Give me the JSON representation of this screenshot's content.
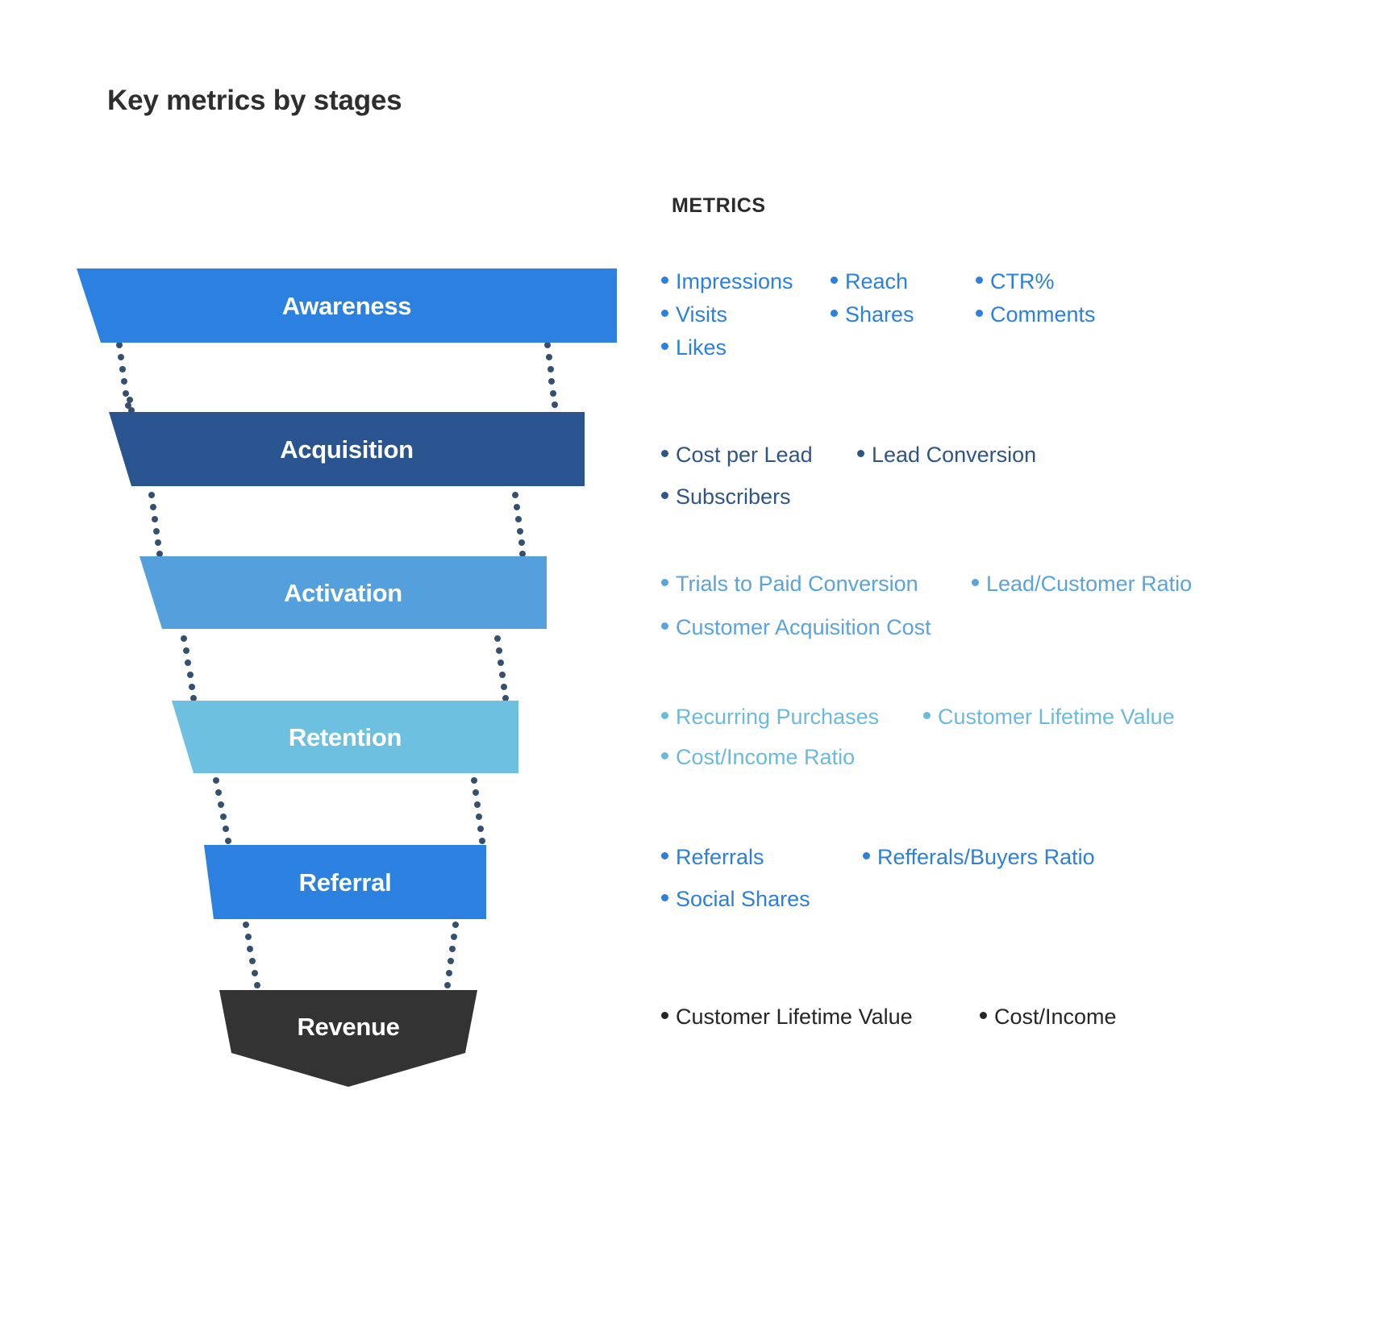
{
  "page": {
    "title": "Key metrics by stages",
    "metrics_heading": "METRICS",
    "background": "#ffffff",
    "title_color": "#2e2e2e"
  },
  "chart_data": {
    "type": "funnel",
    "title": "Key metrics by stages",
    "stages": [
      {
        "name": "Awareness",
        "color": "#2b80e0",
        "text_color": "#2b80e0",
        "metrics": [
          [
            "Impressions",
            "Reach",
            "CTR%"
          ],
          [
            "Visits",
            "Shares",
            "Comments"
          ],
          [
            "Likes"
          ]
        ]
      },
      {
        "name": "Acquisition",
        "color": "#2a5490",
        "text_color": "#2f5488",
        "metrics": [
          [
            "Cost per Lead",
            "Lead Conversion"
          ],
          [
            "Subscribers"
          ]
        ]
      },
      {
        "name": "Activation",
        "color": "#53a0dc",
        "text_color": "#5ba3dc",
        "metrics": [
          [
            "Trials to Paid Conversion",
            "Lead/Customer Ratio"
          ],
          [
            "Customer Acquisition Cost"
          ]
        ]
      },
      {
        "name": "Retention",
        "color": "#6dc0e0",
        "text_color": "#6cbada",
        "metrics": [
          [
            "Recurring Purchases",
            "Customer Lifetime Value"
          ],
          [
            "Cost/Income Ratio"
          ]
        ]
      },
      {
        "name": "Referral",
        "color": "#2b80e0",
        "text_color": "#2d7fd8",
        "metrics": [
          [
            "Referrals",
            "Refferals/Buyers Ratio"
          ],
          [
            "Social Shares"
          ]
        ]
      },
      {
        "name": "Revenue",
        "color": "#333333",
        "text_color": "#262626",
        "metrics": [
          [
            "Customer Lifetime Value",
            "Cost/Income"
          ]
        ]
      }
    ]
  }
}
